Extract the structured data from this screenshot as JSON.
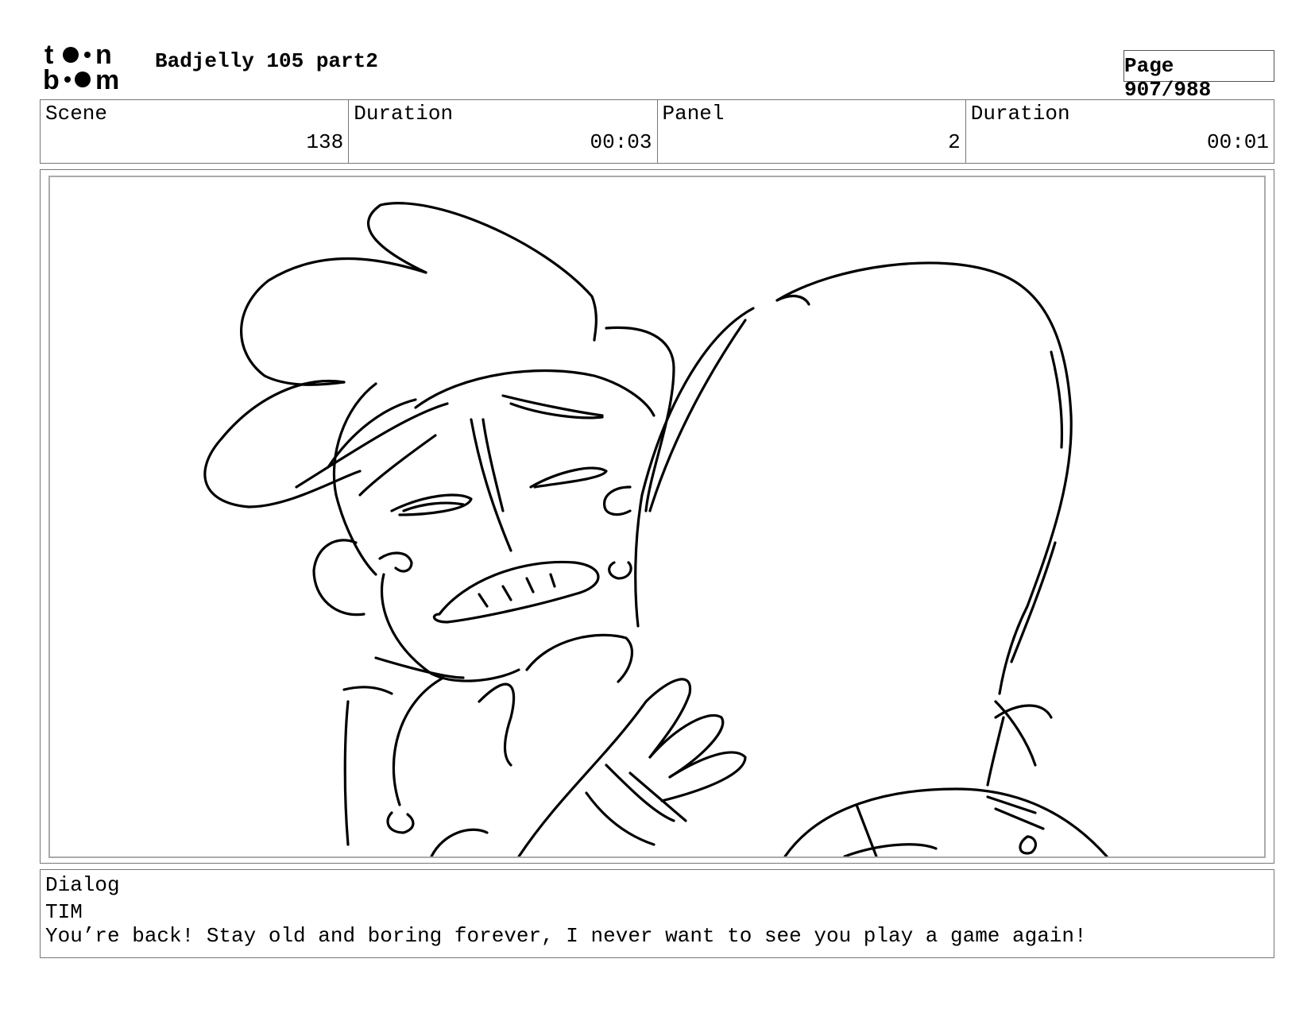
{
  "header": {
    "logo_text": "toon boom",
    "title": "Badjelly 105 part2",
    "page": "Page 907/988"
  },
  "info": {
    "scene_label": "Scene",
    "scene_value": "138",
    "scene_duration_label": "Duration",
    "scene_duration_value": "00:03",
    "panel_label": "Panel",
    "panel_value": "2",
    "panel_duration_label": "Duration",
    "panel_duration_value": "00:01"
  },
  "dialog": {
    "label": "Dialog",
    "speaker": "TIM",
    "line": "You’re back! Stay old and boring forever, I never want to see you play a game again!"
  }
}
